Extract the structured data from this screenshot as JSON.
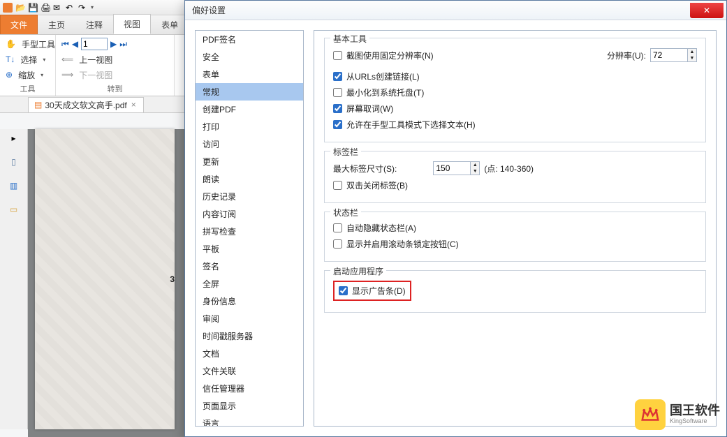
{
  "app": {
    "tabs": [
      "文件",
      "主页",
      "注释",
      "视图",
      "表单"
    ],
    "active_file_tab_idx": 0,
    "active_tab_idx": 3,
    "ribbon": {
      "g1": {
        "hand": "手型工具",
        "select": "选择",
        "zoom": "缩放",
        "label": "工具"
      },
      "g2": {
        "page_input": "1",
        "prev_view": "上一视图",
        "next_view": "下一视图",
        "label": "转到"
      }
    },
    "doc_tab": "30天成文软文高手.pdf",
    "doc_page_big": "3"
  },
  "dialog": {
    "title": "偏好设置",
    "categories": [
      "PDF签名",
      "安全",
      "表单",
      "常规",
      "创建PDF",
      "打印",
      "访问",
      "更新",
      "朗读",
      "历史记录",
      "内容订阅",
      "拼写检查",
      "平板",
      "签名",
      "全屏",
      "身份信息",
      "审阅",
      "时间戳服务器",
      "文档",
      "文件关联",
      "信任管理器",
      "页面显示",
      "语言"
    ],
    "selected_idx": 3,
    "section1": {
      "title": "基本工具",
      "cb1": "截图使用固定分辨率(N)",
      "res_label": "分辨率(U):",
      "res_value": "72",
      "cb2": "从URLs创建链接(L)",
      "cb3": "最小化到系统托盘(T)",
      "cb4": "屏幕取词(W)",
      "cb5": "允许在手型工具模式下选择文本(H)"
    },
    "section2": {
      "title": "标签栏",
      "max_label": "最大标签尺寸(S):",
      "max_value": "150",
      "max_hint": "(点: 140-360)",
      "cb1": "双击关闭标签(B)"
    },
    "section3": {
      "title": "状态栏",
      "cb1": "自动隐藏状态栏(A)",
      "cb2": "显示并启用滚动条锁定按钮(C)"
    },
    "section4": {
      "title": "启动应用程序",
      "cb1": "显示广告条(D)"
    }
  },
  "watermark": {
    "big": "国王软件",
    "small": "KingSoftware"
  }
}
